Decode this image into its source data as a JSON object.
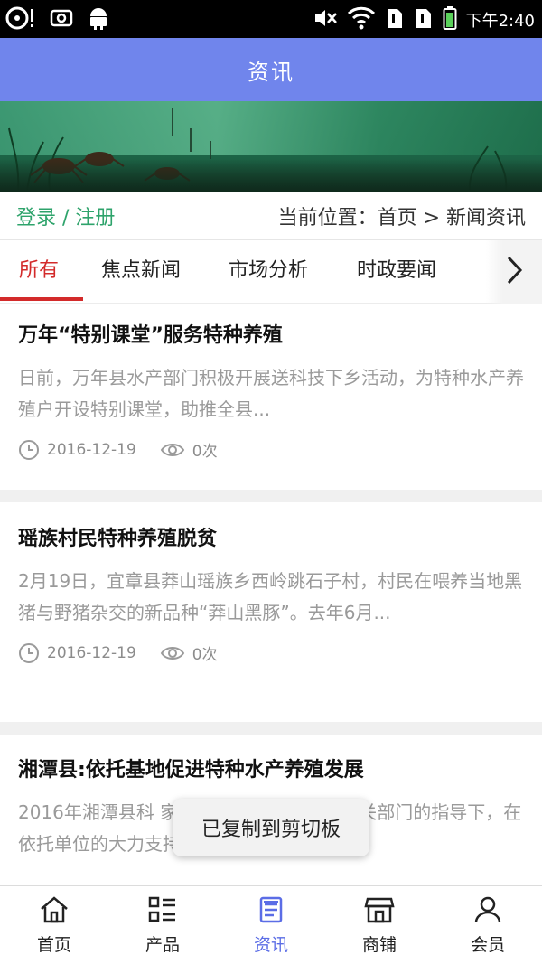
{
  "status_bar": {
    "time": "下午2:40",
    "icons": [
      "media-icon",
      "screenshot-icon",
      "android-icon",
      "mute-icon",
      "wifi-icon",
      "sim1-icon",
      "sim2-icon",
      "battery-icon"
    ]
  },
  "header": {
    "title": "资讯"
  },
  "infobar": {
    "login_label": "登录 / 注册",
    "breadcrumb": "当前位置：首页 > 新闻资讯"
  },
  "tabs": [
    {
      "label": "所有",
      "active": true
    },
    {
      "label": "焦点新闻",
      "active": false
    },
    {
      "label": "市场分析",
      "active": false
    },
    {
      "label": "时政要闻",
      "active": false
    }
  ],
  "articles": [
    {
      "title": "万年“特别课堂”服务特种养殖",
      "summary": "日前，万年县水产部门积极开展送科技下乡活动，为特种水产养殖户开设特别课堂，助推全县...",
      "date": "2016-12-19",
      "views": "0次"
    },
    {
      "title": "瑶族村民特种养殖脱贫",
      "summary": "2月19日，宜章县莽山瑶族乡西岭跳石子村，村民在喂养当地黑猪与野猪杂交的新品种“莽山黑豚”。去年6月...",
      "date": "2016-12-19",
      "views": "0次"
    },
    {
      "title": "湘潭县:依托基地促进特种水产养殖发展",
      "summary": "2016年湘潭县科    家服务基地工作在上级有关部门的指导下，在依托单位的大力支持下，取"
    }
  ],
  "toast": {
    "text": "已复制到剪切板"
  },
  "bottom_nav": [
    {
      "label": "首页",
      "icon": "home-icon",
      "active": false
    },
    {
      "label": "产品",
      "icon": "product-grid-icon",
      "active": false
    },
    {
      "label": "资讯",
      "icon": "news-icon",
      "active": true
    },
    {
      "label": "商铺",
      "icon": "shop-icon",
      "active": false
    },
    {
      "label": "会员",
      "icon": "member-icon",
      "active": false
    }
  ],
  "colors": {
    "header_bg": "#7085ec",
    "active_tab": "#d32a2a",
    "login_green": "#2ea36b",
    "nav_active": "#5b6de6"
  }
}
